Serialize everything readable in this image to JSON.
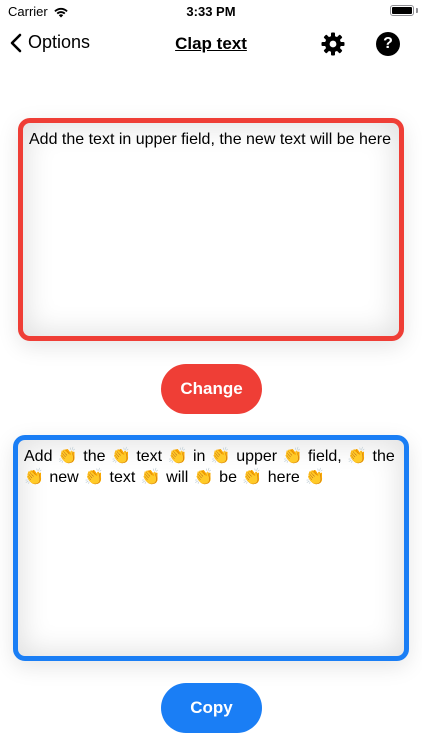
{
  "status_bar": {
    "carrier": "Carrier",
    "time": "3:33 PM"
  },
  "nav": {
    "back_label": "Options",
    "title": "Clap text",
    "settings_icon": "gear-icon",
    "help_icon": "question-mark-circle-icon",
    "help_glyph": "?"
  },
  "input": {
    "text": "Add the text in upper field, the new text will be here",
    "border_color": "#ef3e36"
  },
  "change_button": {
    "label": "Change",
    "color": "#ef3e36"
  },
  "output": {
    "text": "Add 👏 the 👏 text 👏 in 👏 upper 👏 field, 👏 the 👏 new 👏 text 👏 will 👏 be 👏 here 👏",
    "border_color": "#1a7ef5"
  },
  "copy_button": {
    "label": "Copy",
    "color": "#1a7ef5"
  }
}
